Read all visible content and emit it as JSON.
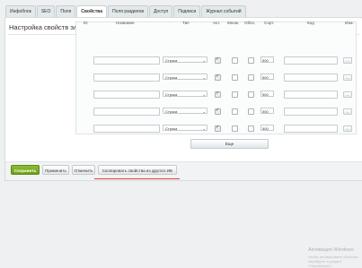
{
  "tabs": [
    "Инфоблок",
    "SEO",
    "Поля",
    "Свойства",
    "Поля разделов",
    "Доступ",
    "Подписи",
    "Журнал событий"
  ],
  "active_tab": "Свойства",
  "panel": {
    "title": "Настройка свойств элементов"
  },
  "columns": {
    "id": "ID",
    "name": "Название",
    "type": "Тип",
    "active": "Акт.",
    "multiple": "Множ.",
    "required": "Обяз.",
    "sort": "Сорт.",
    "code": "Код",
    "edit": "Изм."
  },
  "rows": [
    {
      "id": "",
      "name": "",
      "type": "Строка",
      "active": true,
      "multiple": false,
      "required": false,
      "sort": "500",
      "code": "",
      "edit": "..."
    },
    {
      "id": "",
      "name": "",
      "type": "Строка",
      "active": true,
      "multiple": false,
      "required": false,
      "sort": "500",
      "code": "",
      "edit": "..."
    },
    {
      "id": "",
      "name": "",
      "type": "Строка",
      "active": true,
      "multiple": false,
      "required": false,
      "sort": "500",
      "code": "",
      "edit": "..."
    },
    {
      "id": "",
      "name": "",
      "type": "Строка",
      "active": true,
      "multiple": false,
      "required": false,
      "sort": "500",
      "code": "",
      "edit": "..."
    },
    {
      "id": "",
      "name": "",
      "type": "Строка",
      "active": true,
      "multiple": false,
      "required": false,
      "sort": "500",
      "code": "",
      "edit": "..."
    }
  ],
  "more_button": "Еще",
  "footer": {
    "save": "Сохранить",
    "apply": "Применить",
    "cancel": "Отменить",
    "copy": "Скопировать свойства из другого ИБ"
  },
  "watermark": {
    "line1": "Активация Windows",
    "line2": "Чтобы активировать Windows, перейдите в раздел «Параметры»."
  },
  "colors": {
    "save_green": "#7aaa22",
    "highlight_red": "#e53a3a"
  }
}
